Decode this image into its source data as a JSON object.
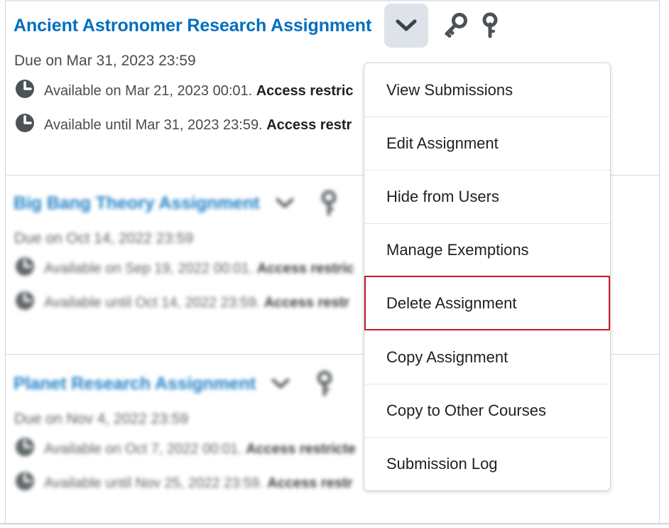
{
  "colors": {
    "link_blue": "#006fbf",
    "text_dark": "#202122",
    "text_body": "#494c4e",
    "divider": "#d3dae0",
    "highlight_red": "#c8192d",
    "chevron_button_bg": "#dde3e9"
  },
  "assignments": [
    {
      "title": "Ancient Astronomer Research Assignment",
      "due": "Due on Mar 31, 2023 23:59",
      "available_on": "Available on Mar 21, 2023 00:01. ",
      "available_on_bold": "Access restric",
      "available_until": "Available until Mar 31, 2023 23:59. ",
      "available_until_bold": "Access restr",
      "chevron_icon": "chevron-down-icon",
      "key_icon": "key-icon",
      "lock_icon": "key-vertical-icon"
    },
    {
      "title": "Big Bang Theory Assignment",
      "due": "Due on Oct 14, 2022 23:59",
      "available_on": "Available on Sep 19, 2022 00:01. ",
      "available_on_bold": "Access restric",
      "available_until": "Available until Oct 14, 2022 23:59. ",
      "available_until_bold": "Access restr",
      "chevron_icon": "chevron-down-icon",
      "key_icon": "key-vertical-icon"
    },
    {
      "title": "Planet Research Assignment",
      "due": "Due on Nov 4, 2022 23:59",
      "available_on": "Available on Oct 7, 2022 00:01. ",
      "available_on_bold": "Access restricte",
      "available_until": "Available until Nov 25, 2022 23:59. ",
      "available_until_bold": "Access restr",
      "chevron_icon": "chevron-down-icon",
      "key_icon": "key-vertical-icon"
    }
  ],
  "context_menu": {
    "items": [
      {
        "label": "View Submissions",
        "highlighted": false
      },
      {
        "label": "Edit Assignment",
        "highlighted": false
      },
      {
        "label": "Hide from Users",
        "highlighted": false
      },
      {
        "label": "Manage Exemptions",
        "highlighted": false
      },
      {
        "label": "Delete Assignment",
        "highlighted": true
      },
      {
        "label": "Copy Assignment",
        "highlighted": false
      },
      {
        "label": "Copy to Other Courses",
        "highlighted": false
      },
      {
        "label": "Submission Log",
        "highlighted": false
      }
    ]
  }
}
